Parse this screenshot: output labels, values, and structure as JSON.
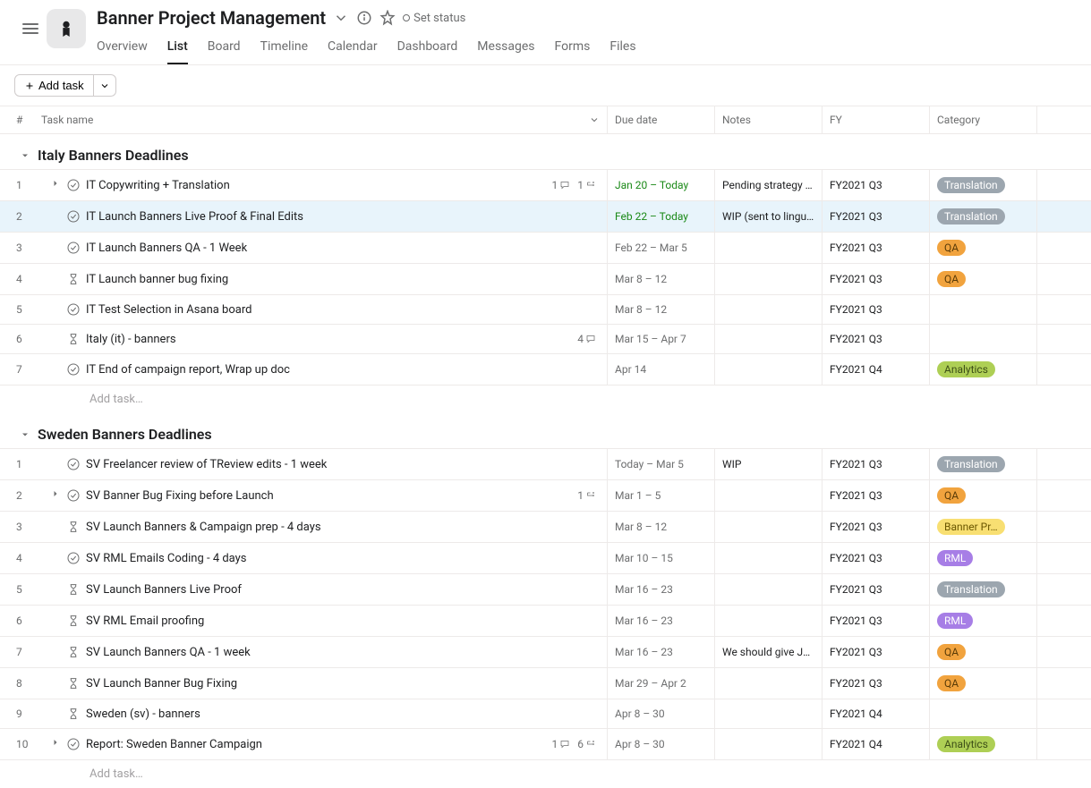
{
  "project": {
    "title": "Banner Project Management",
    "set_status": "Set status"
  },
  "tabs": [
    "Overview",
    "List",
    "Board",
    "Timeline",
    "Calendar",
    "Dashboard",
    "Messages",
    "Forms",
    "Files"
  ],
  "active_tab": "List",
  "toolbar": {
    "add_task": "Add task"
  },
  "columns": {
    "number": "#",
    "name": "Task name",
    "due": "Due date",
    "notes": "Notes",
    "fy": "FY",
    "category": "Category"
  },
  "add_task_placeholder": "Add task…",
  "pill_colors": {
    "Translation": {
      "bg": "#9ca6af",
      "fg": "#ffffff"
    },
    "QA": {
      "bg": "#f1a33e",
      "fg": "#5a3b07"
    },
    "Analytics": {
      "bg": "#aecf55",
      "fg": "#3d4f17"
    },
    "Banner Pr…": {
      "bg": "#f8df72",
      "fg": "#6b5700"
    },
    "RML": {
      "bg": "#a77ee6",
      "fg": "#ffffff"
    }
  },
  "sections": [
    {
      "title": "Italy Banners Deadlines",
      "tasks": [
        {
          "num": "1",
          "icon": "check",
          "expand": true,
          "title": "IT Copywriting + Translation",
          "comments": "1",
          "subtasks": "1",
          "due": "Jan 20 – Today",
          "due_green": true,
          "notes": "Pending strategy …",
          "fy": "FY2021 Q3",
          "cat": "Translation"
        },
        {
          "num": "2",
          "icon": "check",
          "highlight": true,
          "title": "IT Launch Banners Live Proof & Final Edits",
          "due": "Feb 22 – Today",
          "due_green": true,
          "notes": "WIP (sent to lingu…",
          "fy": "FY2021 Q3",
          "cat": "Translation"
        },
        {
          "num": "3",
          "icon": "check",
          "title": "IT Launch Banners QA - 1 Week",
          "due": "Feb 22 – Mar 5",
          "fy": "FY2021 Q3",
          "cat": "QA"
        },
        {
          "num": "4",
          "icon": "hourglass",
          "title": "IT Launch banner bug fixing",
          "due": "Mar 8 – 12",
          "fy": "FY2021 Q3",
          "cat": "QA"
        },
        {
          "num": "5",
          "icon": "check",
          "title": "IT Test Selection in Asana board",
          "due": "Mar 8 – 12",
          "fy": "FY2021 Q3"
        },
        {
          "num": "6",
          "icon": "hourglass",
          "title": "Italy (it) - banners",
          "comments": "4",
          "due": "Mar 15 – Apr 7",
          "fy": "FY2021 Q3"
        },
        {
          "num": "7",
          "icon": "check",
          "title": "IT End of campaign report, Wrap up doc",
          "due": "Apr 14",
          "fy": "FY2021 Q4",
          "cat": "Analytics"
        }
      ]
    },
    {
      "title": "Sweden Banners Deadlines",
      "tasks": [
        {
          "num": "1",
          "icon": "check",
          "title": "SV Freelancer review of TReview edits - 1 week",
          "due": "Today – Mar 5",
          "notes": "WIP",
          "fy": "FY2021 Q3",
          "cat": "Translation"
        },
        {
          "num": "2",
          "icon": "check",
          "expand": true,
          "title": "SV Banner Bug Fixing before Launch",
          "subtasks": "1",
          "due": "Mar 1 – 5",
          "fy": "FY2021 Q3",
          "cat": "QA"
        },
        {
          "num": "3",
          "icon": "hourglass",
          "title": "SV Launch Banners & Campaign prep - 4 days",
          "due": "Mar 8 – 12",
          "fy": "FY2021 Q3",
          "cat": "Banner Pr…"
        },
        {
          "num": "4",
          "icon": "check",
          "title": "SV RML Emails Coding - 4 days",
          "due": "Mar 10 – 15",
          "fy": "FY2021 Q3",
          "cat": "RML"
        },
        {
          "num": "5",
          "icon": "hourglass",
          "title": "SV Launch Banners Live Proof",
          "due": "Mar 16 – 23",
          "fy": "FY2021 Q3",
          "cat": "Translation"
        },
        {
          "num": "6",
          "icon": "hourglass",
          "title": "SV RML Email proofing",
          "due": "Mar 16 – 23",
          "fy": "FY2021 Q3",
          "cat": "RML"
        },
        {
          "num": "7",
          "icon": "hourglass",
          "title": "SV Launch Banners QA - 1 week",
          "due": "Mar 16 – 23",
          "notes": "We should give J…",
          "fy": "FY2021 Q3",
          "cat": "QA"
        },
        {
          "num": "8",
          "icon": "hourglass",
          "title": "SV Launch Banner Bug Fixing",
          "due": "Mar 29 – Apr 2",
          "fy": "FY2021 Q3",
          "cat": "QA"
        },
        {
          "num": "9",
          "icon": "hourglass",
          "title": "Sweden (sv) - banners",
          "due": "Apr 8 – 30",
          "fy": "FY2021 Q4"
        },
        {
          "num": "10",
          "icon": "check",
          "expand": true,
          "title": "Report: Sweden Banner Campaign",
          "comments": "1",
          "subtasks": "6",
          "due": "Apr 8 – 30",
          "fy": "FY2021 Q4",
          "cat": "Analytics"
        }
      ]
    }
  ]
}
